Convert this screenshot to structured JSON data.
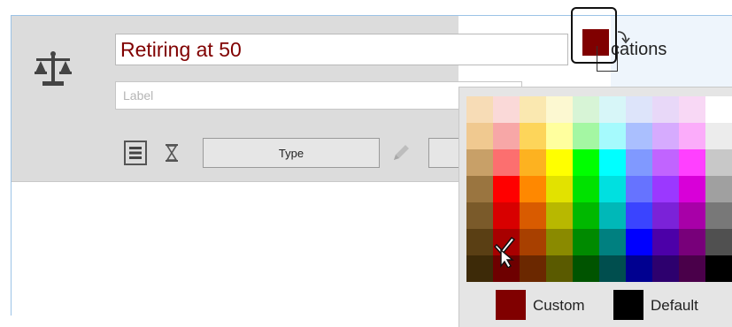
{
  "node": {
    "title_value": "Retiring at 50",
    "label_placeholder": "Label",
    "type_button_label": "Type"
  },
  "background": {
    "applications_text": "cations"
  },
  "color_picker": {
    "selected_color": "#800000",
    "custom_label": "Custom",
    "custom_color": "#800000",
    "default_label": "Default",
    "default_color": "#000000",
    "palette": [
      [
        "#f7dcb6",
        "#fad9d8",
        "#fae8b0",
        "#fcf8d1",
        "#d7f4d6",
        "#d7f6f8",
        "#dde4fa",
        "#e8d8f8",
        "#f8d8f5",
        "#ffffff"
      ],
      [
        "#f0c990",
        "#f7a7a7",
        "#fdd55a",
        "#ffff9e",
        "#a4f7a3",
        "#a5fafd",
        "#aabffe",
        "#d6abfe",
        "#fbacfa",
        "#ececec"
      ],
      [
        "#c8a068",
        "#fc6f6f",
        "#fdb220",
        "#ffff00",
        "#00ff00",
        "#00ffff",
        "#8099ff",
        "#c164ff",
        "#ff40ff",
        "#c8c8c8"
      ],
      [
        "#9a7540",
        "#ff0000",
        "#ff8800",
        "#e2e200",
        "#00e200",
        "#00e0e0",
        "#6673ff",
        "#9b38ff",
        "#d800d8",
        "#a0a0a0"
      ],
      [
        "#7a5a2a",
        "#d80000",
        "#d95b00",
        "#b8b800",
        "#00b800",
        "#00b8b8",
        "#3a44ff",
        "#7b22d8",
        "#a800a8",
        "#787878"
      ],
      [
        "#5a3f14",
        "#a80000",
        "#a84000",
        "#8a8a00",
        "#008a00",
        "#008080",
        "#0000ff",
        "#4c00a8",
        "#78007a",
        "#505050"
      ],
      [
        "#3d2a08",
        "#6e0000",
        "#6b2800",
        "#5a5a00",
        "#005400",
        "#004e4e",
        "#000090",
        "#2d006e",
        "#4a004a",
        "#000000"
      ]
    ]
  }
}
